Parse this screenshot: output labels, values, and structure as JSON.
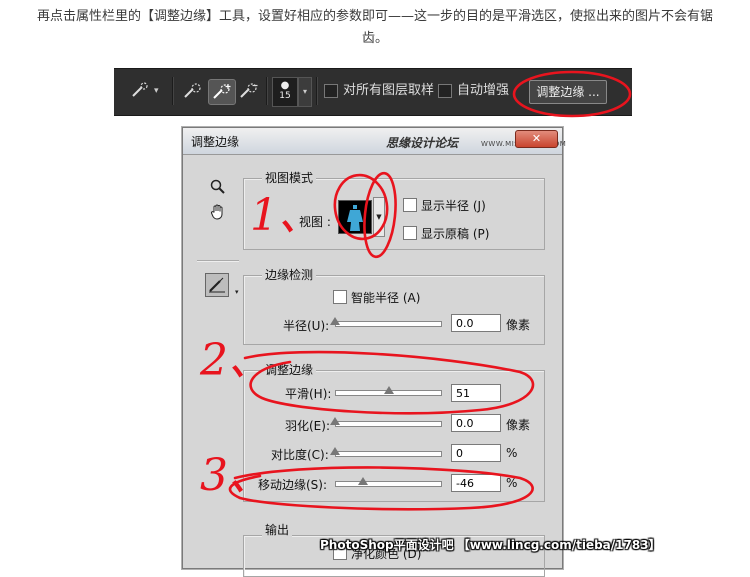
{
  "article": {
    "paragraph_line1": "再点击属性栏里的【调整边缘】工具，设置好相应的参数即可——这一步的目的是平滑选区，使抠出来的图片不会有锯",
    "paragraph_line2": "齿。"
  },
  "toolbar": {
    "brush_size": "15",
    "sample_all_layers": "对所有图层取样",
    "auto_enhance": "自动增强",
    "refine_edge_button": "调整边缘 ..."
  },
  "dialog": {
    "title": "调整边缘",
    "watermark": "思缘设计论坛",
    "watermark_url": "WWW.MISSYUAN.COM",
    "view_mode": {
      "title": "视图模式",
      "view_label": "视图 :",
      "show_radius": "显示半径",
      "show_radius_key": "(J)",
      "show_original": "显示原稿",
      "show_original_key": "(P)"
    },
    "edge_detection": {
      "title": "边缘检测",
      "smart_radius": "智能半径",
      "smart_radius_key": "(A)",
      "radius_label": "半径(U):",
      "radius_value": "0.0",
      "radius_unit": "像素"
    },
    "adjust_edge": {
      "title": "调整边缘",
      "smooth_label": "平滑(H):",
      "smooth_value": "51",
      "feather_label": "羽化(E):",
      "feather_value": "0.0",
      "feather_unit": "像素",
      "contrast_label": "对比度(C):",
      "contrast_value": "0",
      "contrast_unit": "%",
      "shift_edge_label": "移动边缘(S):",
      "shift_edge_value": "-46",
      "shift_edge_unit": "%"
    },
    "output": {
      "title": "输出",
      "decontaminate": "净化颜色 (D)"
    }
  },
  "slider_levels": {
    "radius": 0.0,
    "smooth": 0.51,
    "feather": 0.0,
    "contrast": 0.0,
    "shift_edge": 0.27
  },
  "footer_watermark": "PhotoShop平面设计吧 【www.lincg.com/tieba/1783】",
  "annotations": {
    "mark1": "1、",
    "mark2": "2、",
    "mark3": "3、",
    "color": "#e8141e"
  }
}
